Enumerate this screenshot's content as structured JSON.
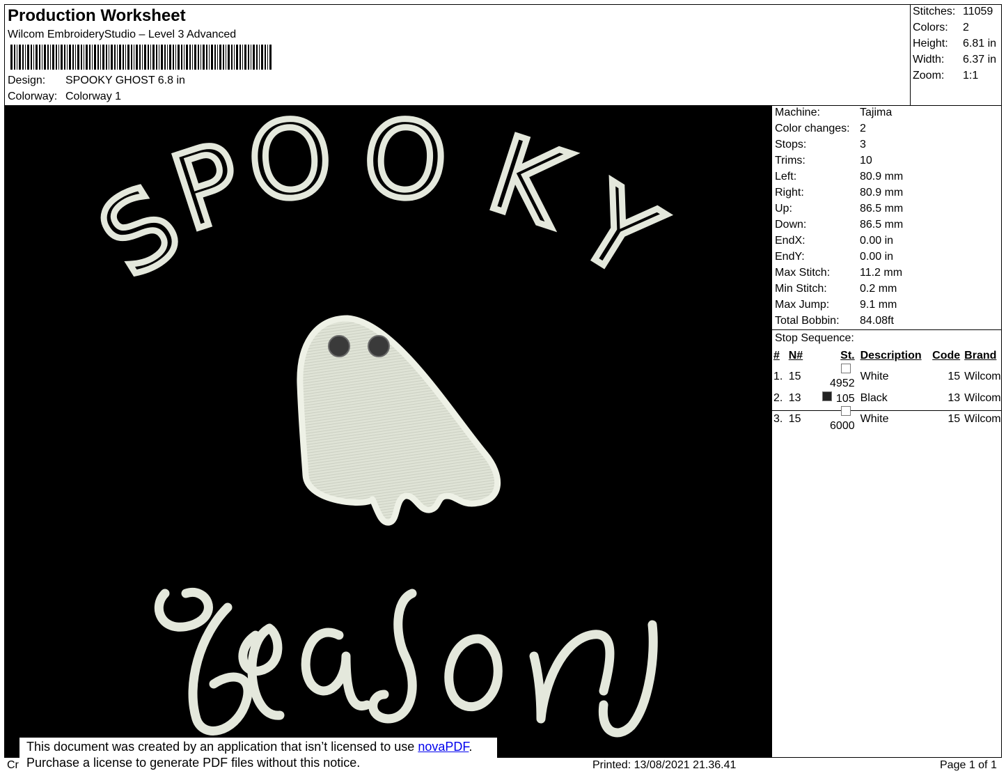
{
  "header": {
    "title": "Production Worksheet",
    "software": "Wilcom EmbroideryStudio – Level 3 Advanced",
    "design_label": "Design:",
    "design_value": "SPOOKY GHOST 6.8 in",
    "colorway_label": "Colorway:",
    "colorway_value": "Colorway 1"
  },
  "stats": [
    {
      "label": "Stitches:",
      "value": "11059"
    },
    {
      "label": "Colors:",
      "value": "2"
    },
    {
      "label": "Height:",
      "value": "6.81 in"
    },
    {
      "label": "Width:",
      "value": "6.37 in"
    },
    {
      "label": "Zoom:",
      "value": "1:1"
    }
  ],
  "machine_info": [
    {
      "label": "Machine:",
      "value": "Tajima"
    },
    {
      "label": "Color changes:",
      "value": "2"
    },
    {
      "label": "Stops:",
      "value": "3"
    },
    {
      "label": "Trims:",
      "value": "10"
    },
    {
      "label": "Left:",
      "value": "80.9 mm"
    },
    {
      "label": "Right:",
      "value": "80.9 mm"
    },
    {
      "label": "Up:",
      "value": "86.5 mm"
    },
    {
      "label": "Down:",
      "value": "86.5 mm"
    },
    {
      "label": "EndX:",
      "value": "0.00 in"
    },
    {
      "label": "EndY:",
      "value": "0.00 in"
    },
    {
      "label": "Max Stitch:",
      "value": "11.2 mm"
    },
    {
      "label": "Min Stitch:",
      "value": "0.2 mm"
    },
    {
      "label": "Max Jump:",
      "value": "9.1 mm"
    },
    {
      "label": "Total Bobbin:",
      "value": "84.08ft"
    }
  ],
  "stop_sequence": {
    "title": "Stop Sequence:",
    "headers": [
      "#",
      "N#",
      "St.",
      "Description",
      "Code",
      "Brand"
    ],
    "rows": [
      {
        "idx": "1.",
        "n": "15",
        "swatch": "#ffffff",
        "st": "4952",
        "desc": "White",
        "code": "15",
        "brand": "Wilcom"
      },
      {
        "idx": "2.",
        "n": "13",
        "swatch": "#222222",
        "st": "105",
        "desc": "Black",
        "code": "13",
        "brand": "Wilcom"
      },
      {
        "idx": "3.",
        "n": "15",
        "swatch": "#ffffff",
        "st": "6000",
        "desc": "White",
        "code": "15",
        "brand": "Wilcom"
      }
    ]
  },
  "design": {
    "top_text": "SPOOKY",
    "bottom_text": "season",
    "background_color": "#000000",
    "thread_color": "#e4e8dc",
    "eye_color": "#3a3a3a"
  },
  "notice": {
    "line1_prefix": "This document was created by an application that isn’t licensed to use ",
    "link": "novaPDF",
    "line1_suffix": ".",
    "line2": "Purchase a license to generate PDF files without this notice."
  },
  "footer": {
    "left": "Cr",
    "printed": "Printed: 13/08/2021 21.36.41",
    "page": "Page 1 of 1"
  }
}
